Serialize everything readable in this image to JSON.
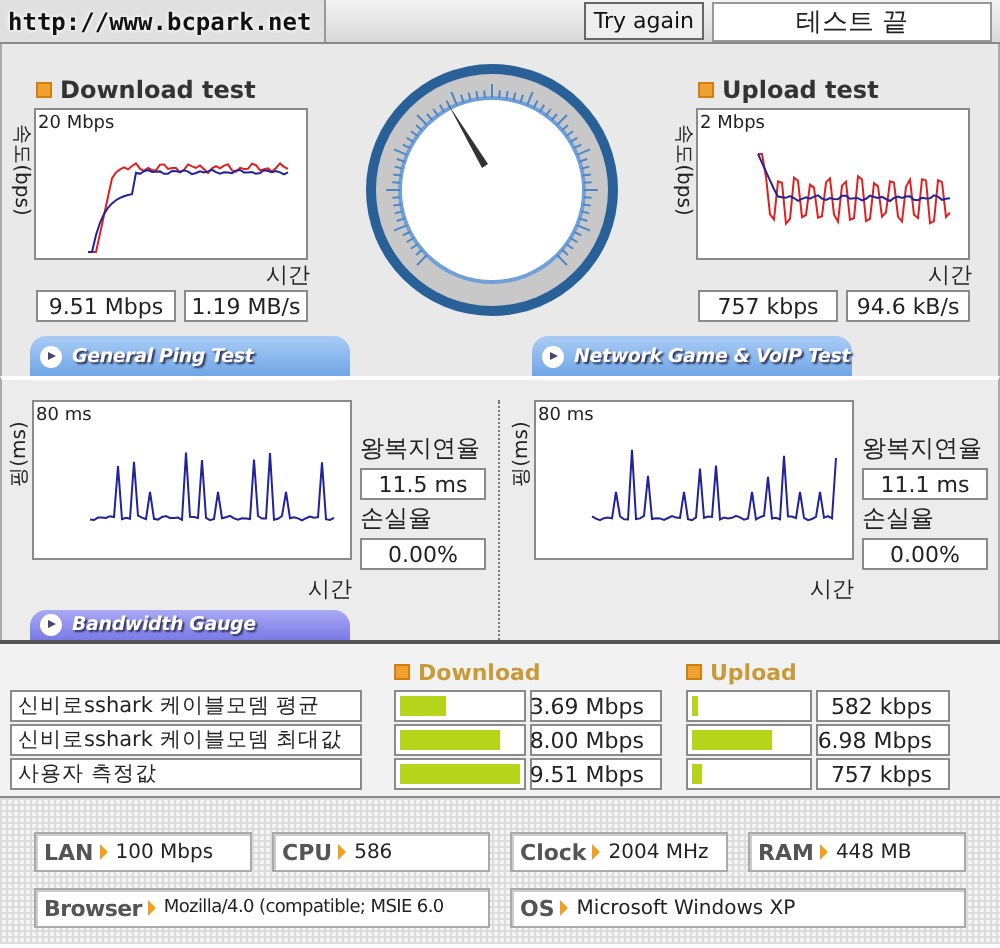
{
  "window": {
    "title": "http://www.bcpark.net"
  },
  "toolbar": {
    "retry_button": "Try again",
    "status": "테스트 끝"
  },
  "speed_tests": [
    {
      "kind": "download",
      "title": "Download test",
      "y_axis_label": "속도(bps)",
      "max_label": "20 Mbps",
      "x_axis_label": "시간",
      "readings": [
        "9.51 Mbps",
        "1.19 MB/s"
      ]
    },
    {
      "kind": "upload",
      "title": "Upload test",
      "y_axis_label": "속도(bps)",
      "max_label": "2 Mbps",
      "x_axis_label": "시간",
      "readings": [
        "757 kbps",
        "94.6 kB/s"
      ]
    }
  ],
  "ping_tabs": [
    {
      "label": "General Ping Test"
    },
    {
      "label": "Network Game & VoIP Test"
    }
  ],
  "ping_tests": [
    {
      "y_axis_label": "핑(ms)",
      "max_label": "80 ms",
      "x_axis_label": "시간",
      "latency_label": "왕복지연율",
      "latency": "11.5 ms",
      "loss_label": "손실율",
      "loss": "0.00%"
    },
    {
      "y_axis_label": "핑(ms)",
      "max_label": "80 ms",
      "x_axis_label": "시간",
      "latency_label": "왕복지연율",
      "latency": "11.1 ms",
      "loss_label": "손실율",
      "loss": "0.00%"
    }
  ],
  "bandwidth": {
    "tab": "Bandwidth Gauge",
    "columns": [
      "Download",
      "Upload"
    ],
    "rows": [
      {
        "name": "신비로sshark 케이블모뎀 평균",
        "download": {
          "level": 0.39,
          "value": "3.69 Mbps"
        },
        "upload": {
          "level": 0.06,
          "value": "582 kbps"
        }
      },
      {
        "name": "신비로sshark 케이블모뎀 최대값",
        "download": {
          "level": 0.84,
          "value": "8.00 Mbps"
        },
        "upload": {
          "level": 0.7,
          "value": "6.98 Mbps"
        }
      },
      {
        "name": "사용자 측정값",
        "download": {
          "level": 1.0,
          "value": "9.51 Mbps"
        },
        "upload": {
          "level": 0.08,
          "value": "757 kbps"
        }
      }
    ]
  },
  "system_info": [
    [
      {
        "label": "LAN",
        "value": "100 Mbps"
      },
      {
        "label": "CPU",
        "value": "586"
      },
      {
        "label": "Clock",
        "value": "2004 MHz"
      },
      {
        "label": "RAM",
        "value": "448 MB"
      }
    ],
    [
      {
        "label": "Browser",
        "value": "Mozilla/4.0 (compatible; MSIE 6.0"
      },
      {
        "label": "OS",
        "value": "Microsoft Windows XP"
      }
    ]
  ]
}
